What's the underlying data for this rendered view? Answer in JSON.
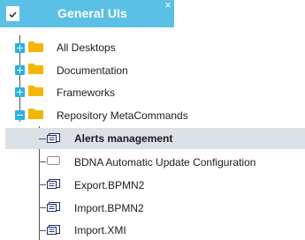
{
  "header": {
    "title": "General UIs",
    "close_glyph": "×",
    "app_icon": "document-check-icon"
  },
  "tree": {
    "folders": [
      {
        "label": "All Desktops",
        "expanded": false,
        "icon": "folder-icon"
      },
      {
        "label": "Documentation",
        "expanded": false,
        "icon": "folder-icon"
      },
      {
        "label": "Frameworks",
        "expanded": false,
        "icon": "folder-icon"
      },
      {
        "label": "Repository MetaCommands",
        "expanded": true,
        "icon": "folder-icon"
      }
    ],
    "children": [
      {
        "label": "Alerts management",
        "selected": true,
        "icon": "metacommand-icon"
      },
      {
        "label": "BDNA Automatic Update Configuration",
        "selected": false,
        "icon": "blank-command-icon"
      },
      {
        "label": "Export.BPMN2",
        "selected": false,
        "icon": "metacommand-icon"
      },
      {
        "label": "Import.BPMN2",
        "selected": false,
        "icon": "metacommand-icon"
      },
      {
        "label": "Import.XMI",
        "selected": false,
        "icon": "metacommand-icon"
      }
    ]
  },
  "colors": {
    "header_bg": "#5bc0e6",
    "expander": "#2ab1e2",
    "folder": "#f2b705",
    "selection_bg": "#dce1e8",
    "command_icon": "#1c2f6b"
  }
}
